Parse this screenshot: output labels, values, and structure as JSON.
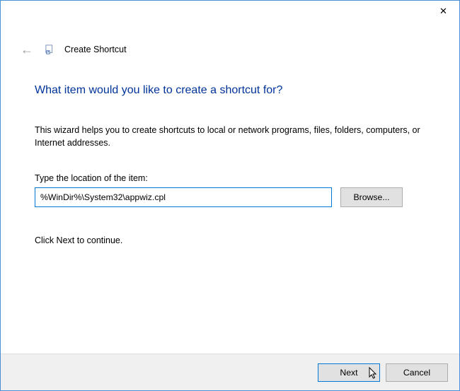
{
  "titlebar": {
    "close": "✕"
  },
  "header": {
    "title": "Create Shortcut"
  },
  "page": {
    "heading": "What item would you like to create a shortcut for?",
    "description": "This wizard helps you to create shortcuts to local or network programs, files, folders, computers, or Internet addresses.",
    "label": "Type the location of the item:",
    "input_value": "%WinDir%\\System32\\appwiz.cpl",
    "browse": "Browse...",
    "continue_hint": "Click Next to continue."
  },
  "footer": {
    "next": "Next",
    "cancel": "Cancel"
  }
}
